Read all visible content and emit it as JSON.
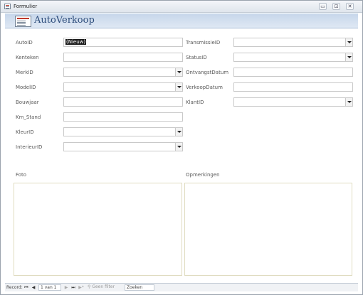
{
  "window": {
    "title": "Formulier",
    "minimize_glyph": "▭",
    "restore_glyph": "⊡",
    "close_glyph": "✕"
  },
  "header": {
    "title": "AutoVerkoop",
    "icon": "form-icon"
  },
  "fields_left": [
    {
      "label": "AutoID",
      "value": "(Nieuw)",
      "type": "text"
    },
    {
      "label": "Kenteken",
      "value": "",
      "type": "text"
    },
    {
      "label": "MerkID",
      "value": "",
      "type": "combo"
    },
    {
      "label": "ModelID",
      "value": "",
      "type": "combo"
    },
    {
      "label": "Bouwjaar",
      "value": "",
      "type": "text"
    },
    {
      "label": "Km_Stand",
      "value": "",
      "type": "text"
    },
    {
      "label": "KleurID",
      "value": "",
      "type": "combo"
    },
    {
      "label": "InterieurID",
      "value": "",
      "type": "combo"
    }
  ],
  "fields_right": [
    {
      "label": "TransmissieID",
      "value": "",
      "type": "combo"
    },
    {
      "label": "StatusID",
      "value": "",
      "type": "combo"
    },
    {
      "label": "OntvangstDatum",
      "value": "",
      "type": "text"
    },
    {
      "label": "VerkoopDatum",
      "value": "",
      "type": "text"
    },
    {
      "label": "KlantID",
      "value": "",
      "type": "combo"
    }
  ],
  "sections": {
    "photo_label": "Foto",
    "notes_label": "Opmerkingen"
  },
  "status": {
    "record_label": "Record:",
    "position": "1 van 1",
    "filter_label": "Geen filter",
    "search_placeholder": "Zoeken",
    "first_glyph": "⏮",
    "prev_glyph": "◀",
    "next_glyph": "▶",
    "last_glyph": "⏭",
    "new_glyph": "▶*"
  }
}
